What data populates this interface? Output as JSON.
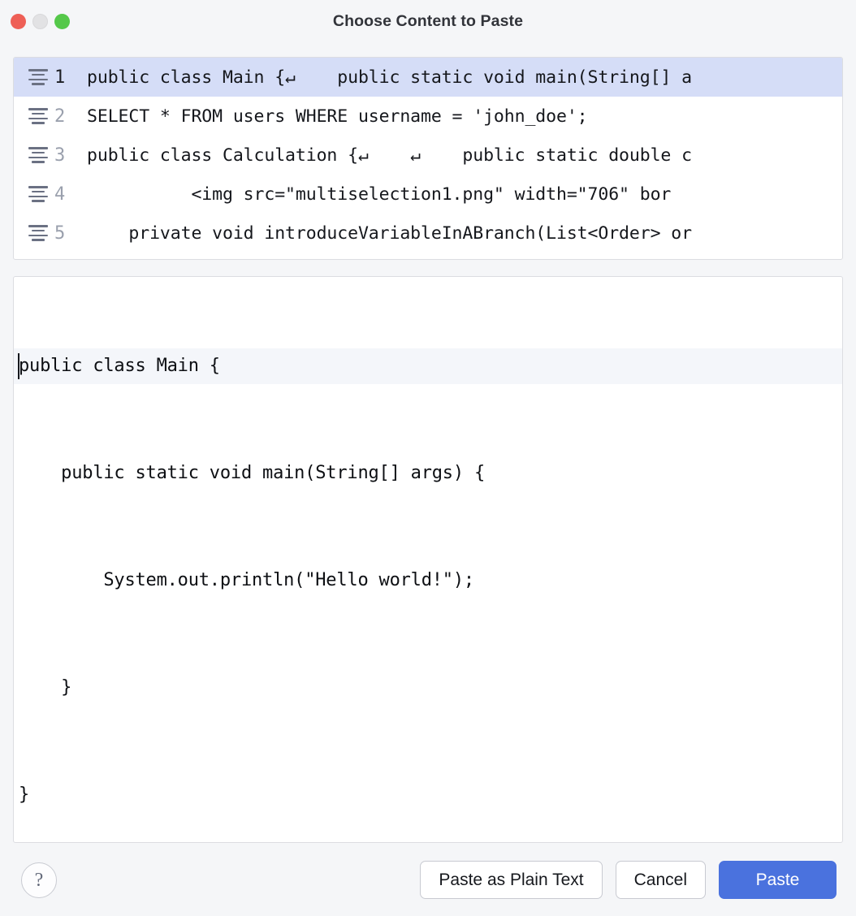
{
  "window": {
    "title": "Choose Content to Paste",
    "traffic_lights": [
      {
        "name": "close-button",
        "color": "#ee5f56"
      },
      {
        "name": "minimize-button",
        "color": "#e2e2e4"
      },
      {
        "name": "zoom-button",
        "color": "#55c84a"
      }
    ]
  },
  "clipboard_list": {
    "selected_index": 0,
    "items": [
      {
        "number": "1",
        "icon": "text-lines-icon",
        "text": "public class Main {↵    public static void main(String[] a",
        "selected": true
      },
      {
        "number": "2",
        "icon": "text-lines-icon",
        "text": "SELECT * FROM users WHERE username = 'john_doe';",
        "selected": false
      },
      {
        "number": "3",
        "icon": "text-lines-icon",
        "text": "public class Calculation {↵    ↵    public static double c",
        "selected": false
      },
      {
        "number": "4",
        "icon": "text-lines-icon",
        "text": "          <img src=\"multiselection1.png\" width=\"706\" bor",
        "selected": false
      },
      {
        "number": "5",
        "icon": "text-lines-icon",
        "text": "    private void introduceVariableInABranch(List<Order> or",
        "selected": false
      }
    ]
  },
  "preview": {
    "lines": [
      "public class Main {",
      "    public static void main(String[] args) {",
      "        System.out.println(\"Hello world!\");",
      "    }",
      "}"
    ],
    "caret_line_index": 0
  },
  "footer": {
    "help_label": "?",
    "buttons": [
      {
        "name": "paste-as-plain-text-button",
        "label": "Paste as Plain Text",
        "style": "secondary"
      },
      {
        "name": "cancel-button",
        "label": "Cancel",
        "style": "secondary"
      },
      {
        "name": "paste-button",
        "label": "Paste",
        "style": "primary"
      }
    ]
  },
  "colors": {
    "accent": "#4a72de",
    "selection": "#d5ddf7",
    "panel_background": "#ffffff",
    "window_background": "#f5f6f8",
    "caret_line": "#f4f6fa"
  }
}
